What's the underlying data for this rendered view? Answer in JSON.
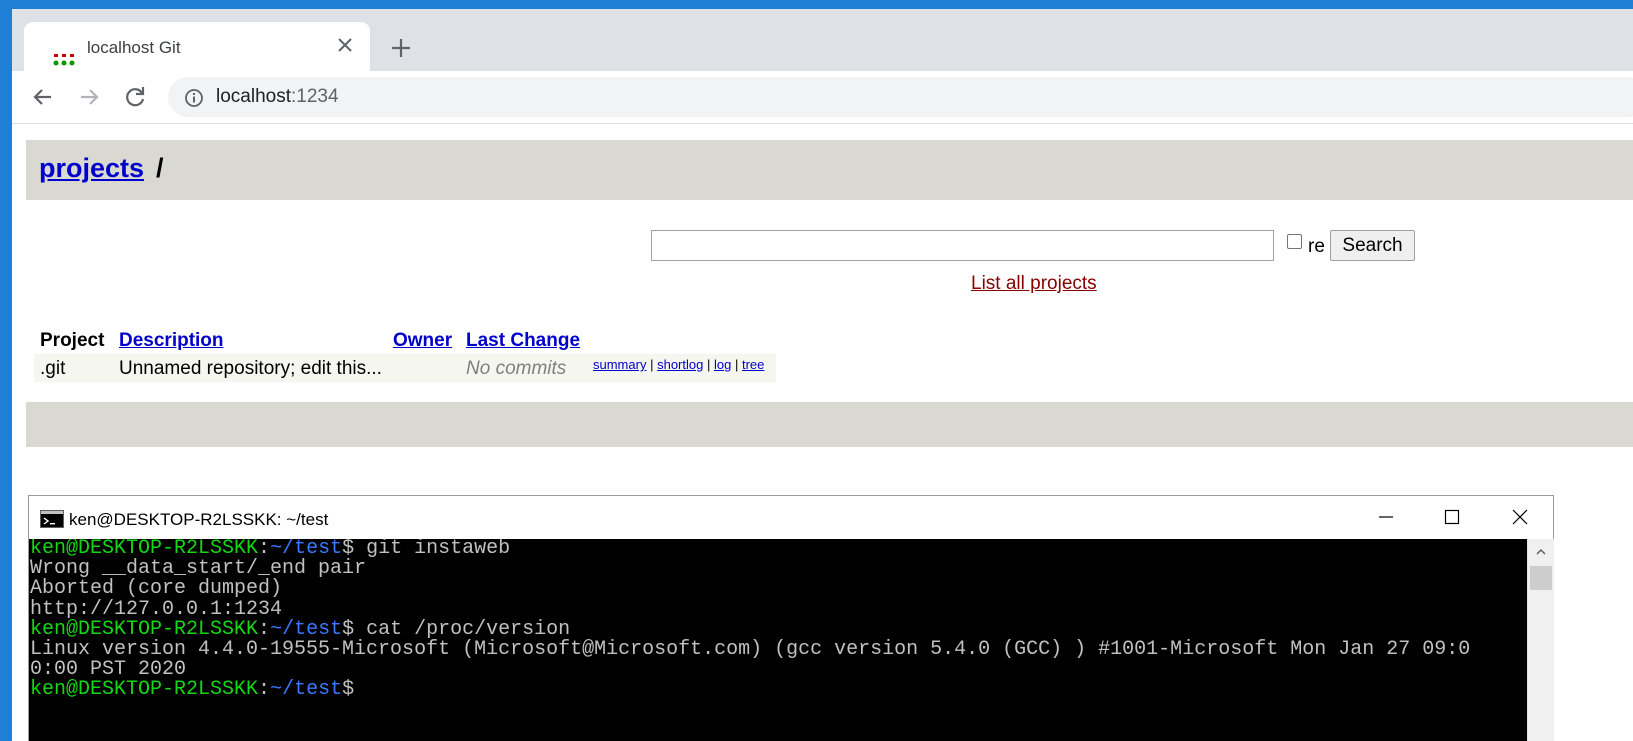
{
  "browser": {
    "tab": {
      "title": "localhost Git"
    },
    "address": {
      "host": "localhost",
      "port": ":1234"
    }
  },
  "page": {
    "header": {
      "link": "projects",
      "separator": "/"
    },
    "search": {
      "value": "",
      "regex_label": "re",
      "button": "Search"
    },
    "list_all_link": "List all projects",
    "table": {
      "headers": {
        "project": "Project",
        "description": "Description",
        "owner": "Owner",
        "last_change": "Last Change"
      },
      "rows": [
        {
          "project": ".git",
          "description": "Unnamed repository; edit this...",
          "owner": "",
          "last_change": "No commits",
          "links": {
            "summary": "summary",
            "shortlog": "shortlog",
            "log": "log",
            "tree": "tree"
          },
          "sep": "|"
        }
      ]
    }
  },
  "terminal": {
    "title": "ken@DESKTOP-R2LSSKK: ~/test",
    "prompt_user": "ken@DESKTOP-R2LSSKK",
    "prompt_colon": ":",
    "prompt_path": "~/test",
    "prompt_dollar": "$",
    "lines": [
      {
        "type": "cmd",
        "text": " git instaweb"
      },
      {
        "type": "out",
        "text": "Wrong __data_start/_end pair"
      },
      {
        "type": "out",
        "text": "Aborted (core dumped)"
      },
      {
        "type": "out",
        "text": "http://127.0.0.1:1234"
      },
      {
        "type": "cmd",
        "text": " cat /proc/version"
      },
      {
        "type": "out",
        "text": "Linux version 4.4.0-19555-Microsoft (Microsoft@Microsoft.com) (gcc version 5.4.0 (GCC) ) #1001-Microsoft Mon Jan 27 09:0"
      },
      {
        "type": "out",
        "text": "0:00 PST 2020"
      },
      {
        "type": "cmd",
        "text": ""
      }
    ]
  },
  "colors": {
    "link": "#0000cc",
    "list_all_link": "#880000",
    "header_bg": "#d9d8d1",
    "prompt_user": "#13d913",
    "prompt_path": "#3a78ff",
    "desktop": "#1e7fd4"
  }
}
